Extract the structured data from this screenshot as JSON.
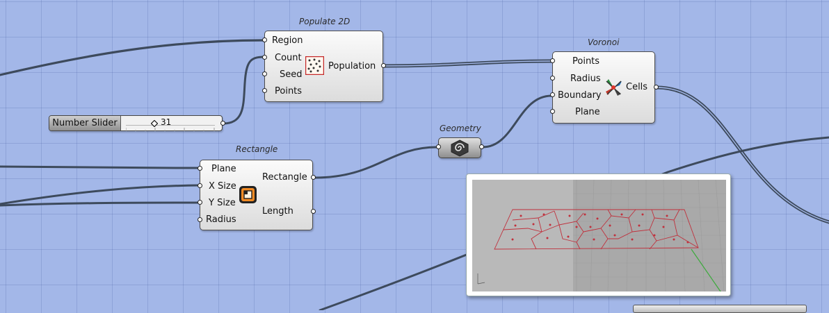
{
  "populate2d": {
    "title": "Populate 2D",
    "inputs": [
      "Region",
      "Count",
      "Seed",
      "Points"
    ],
    "output": "Population",
    "icon": "populate-points-icon"
  },
  "voronoi": {
    "title": "Voronoi",
    "inputs": [
      "Points",
      "Radius",
      "Boundary",
      "Plane"
    ],
    "output": "Cells",
    "icon": "voronoi-icon"
  },
  "rectangle": {
    "title": "Rectangle",
    "inputs": [
      "Plane",
      "X Size",
      "Y Size",
      "Radius"
    ],
    "outputs": [
      "Rectangle",
      "Length"
    ],
    "icon": "rectangle-icon"
  },
  "geometry": {
    "title": "Geometry",
    "icon": "geometry-hexagon-icon"
  },
  "slider": {
    "label": "Number Slider",
    "value": "31"
  },
  "preview": {
    "description": "",
    "accent": "#c0303c"
  },
  "colors": {
    "canvas": "#a3b7e8",
    "wire": "#3d4a5c"
  }
}
